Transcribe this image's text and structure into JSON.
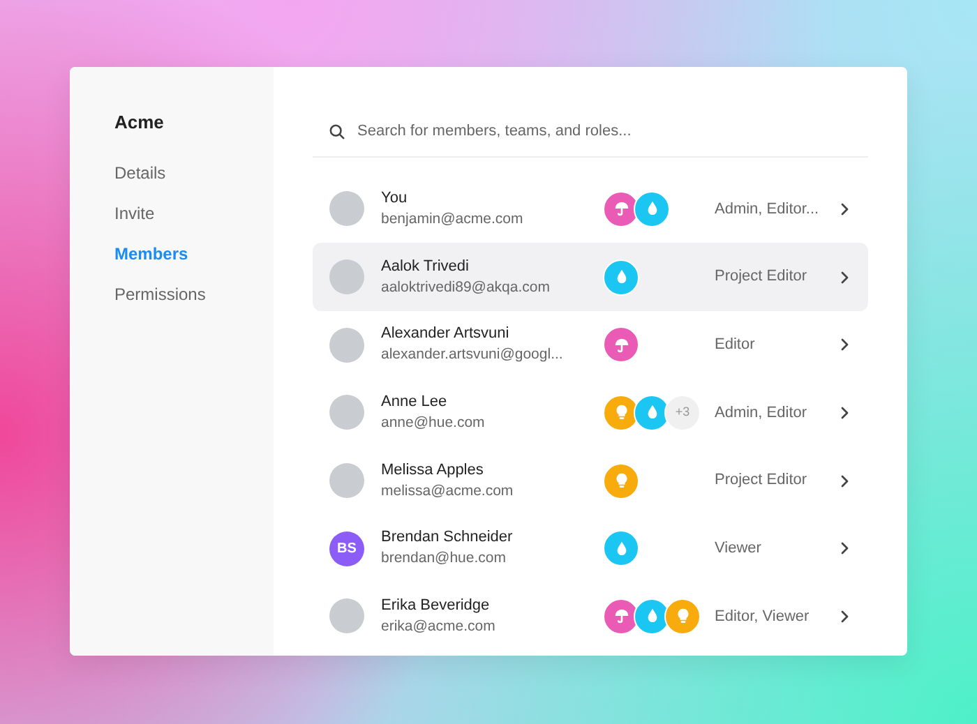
{
  "sidebar": {
    "title": "Acme",
    "items": [
      {
        "label": "Details",
        "selected": false
      },
      {
        "label": "Invite",
        "selected": false
      },
      {
        "label": "Members",
        "selected": true
      },
      {
        "label": "Permissions",
        "selected": false
      }
    ]
  },
  "search": {
    "placeholder": "Search for members, teams, and roles..."
  },
  "members": [
    {
      "name": "You",
      "email": "benjamin@acme.com",
      "avatar": {
        "kind": "photo"
      },
      "teams": [
        {
          "kind": "umbrella"
        },
        {
          "kind": "drop"
        }
      ],
      "role": "Admin, Editor...",
      "selected": false
    },
    {
      "name": "Aalok Trivedi",
      "email": "aaloktrivedi89@akqa.com",
      "avatar": {
        "kind": "photo"
      },
      "teams": [
        {
          "kind": "drop"
        }
      ],
      "role": "Project Editor",
      "selected": true
    },
    {
      "name": "Alexander Artsvuni",
      "email": "alexander.artsvuni@googl...",
      "avatar": {
        "kind": "photo"
      },
      "teams": [
        {
          "kind": "umbrella"
        }
      ],
      "role": "Editor",
      "selected": false
    },
    {
      "name": "Anne Lee",
      "email": "anne@hue.com",
      "avatar": {
        "kind": "photo"
      },
      "teams": [
        {
          "kind": "bulb"
        },
        {
          "kind": "drop"
        },
        {
          "kind": "more",
          "text": "+3"
        }
      ],
      "role": "Admin, Editor",
      "selected": false
    },
    {
      "name": "Melissa Apples",
      "email": "melissa@acme.com",
      "avatar": {
        "kind": "photo"
      },
      "teams": [
        {
          "kind": "bulb"
        }
      ],
      "role": "Project Editor",
      "selected": false
    },
    {
      "name": "Brendan Schneider",
      "email": "brendan@hue.com",
      "avatar": {
        "kind": "initials",
        "text": "BS",
        "color": "#8b5cf6"
      },
      "teams": [
        {
          "kind": "drop"
        }
      ],
      "role": "Viewer",
      "selected": false
    },
    {
      "name": "Erika Beveridge",
      "email": "erika@acme.com",
      "avatar": {
        "kind": "photo"
      },
      "teams": [
        {
          "kind": "umbrella"
        },
        {
          "kind": "drop"
        },
        {
          "kind": "bulb"
        }
      ],
      "role": "Editor, Viewer",
      "selected": false
    }
  ]
}
